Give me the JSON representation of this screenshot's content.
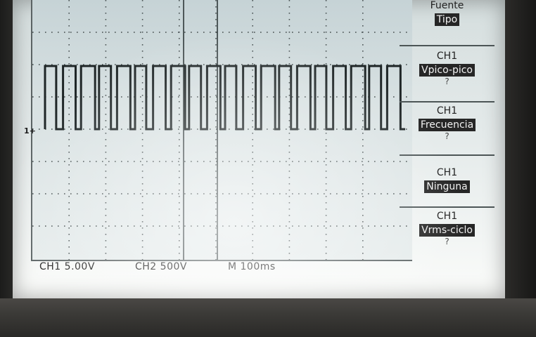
{
  "scope": {
    "ch1_scale": "CH1 5.00V",
    "ch2_scale": "CH2 500V",
    "timebase": "M 100ms",
    "ch1_marker": "1+"
  },
  "menu": {
    "items": [
      {
        "title": "Fuente",
        "value": "Tipo",
        "note": ""
      },
      {
        "title": "CH1",
        "value": "Vpico-pico",
        "note": "?"
      },
      {
        "title": "CH1",
        "value": "Frecuencia",
        "note": "?"
      },
      {
        "title": "CH1",
        "value": "Ninguna",
        "note": ""
      },
      {
        "title": "CH1",
        "value": "Vrms-ciclo",
        "note": "?"
      }
    ]
  },
  "colors": {
    "trace": "#1e2526",
    "highlight": "#262626"
  }
}
